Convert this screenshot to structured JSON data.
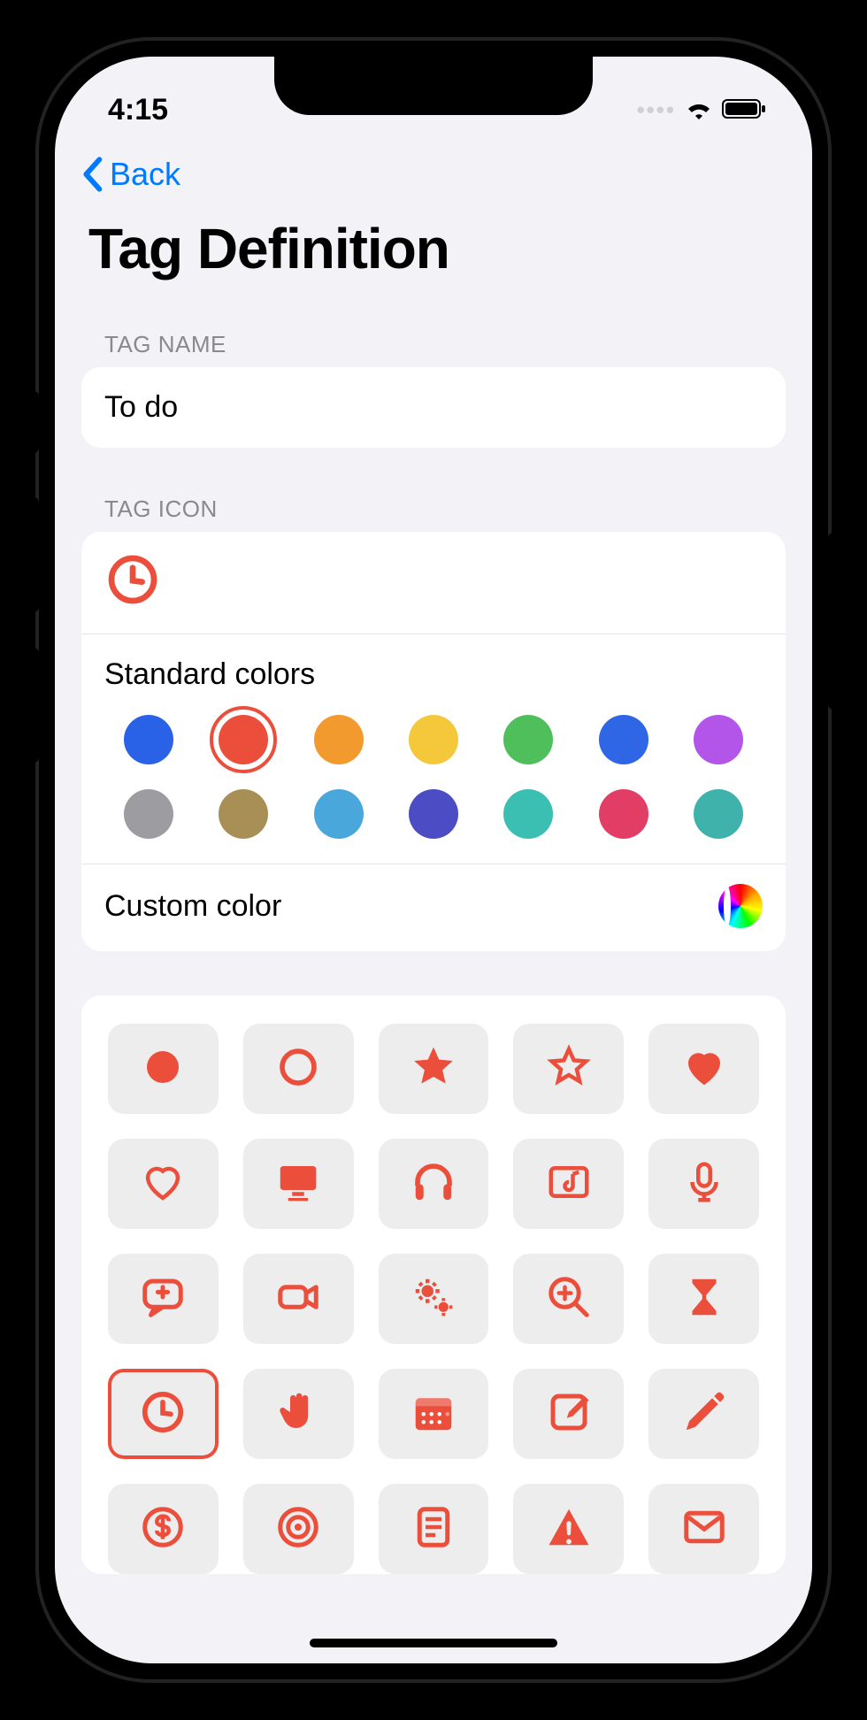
{
  "status": {
    "time": "4:15"
  },
  "nav": {
    "back_label": "Back"
  },
  "page": {
    "title": "Tag Definition"
  },
  "sections": {
    "tag_name_header": "TAG NAME",
    "tag_icon_header": "TAG ICON"
  },
  "tag_name": {
    "value": "To do"
  },
  "accent_color": "#EB4F3C",
  "color_section": {
    "standard_label": "Standard colors",
    "custom_label": "Custom color",
    "selected_index": 1,
    "colors": [
      "#2962E6",
      "#EB4F3C",
      "#F29A2E",
      "#F5C83C",
      "#4FBF5B",
      "#2F66E6",
      "#B255E8",
      "#9D9CA1",
      "#A88F55",
      "#49A7DC",
      "#4C4CC4",
      "#3CBFB3",
      "#E23D65",
      "#3FB3AB"
    ],
    "custom_preview": "#EB4F3C"
  },
  "icons": {
    "selected_index": 15,
    "items": [
      "circle-fill",
      "circle-outline",
      "star-fill",
      "star-outline",
      "heart-fill",
      "heart-outline",
      "monitor",
      "headphones",
      "music-screen",
      "microphone",
      "chat-plus",
      "video-camera",
      "gears",
      "zoom-plus",
      "hourglass",
      "clock",
      "hand-wave",
      "calendar",
      "compose",
      "pencil",
      "dollar-circle",
      "target",
      "document-list",
      "warning-triangle",
      "envelope"
    ]
  }
}
